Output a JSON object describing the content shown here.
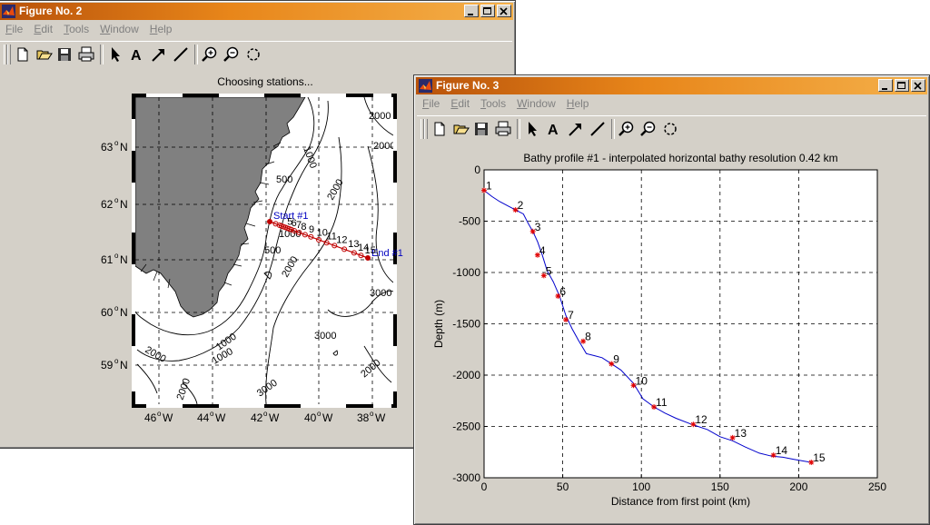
{
  "window2": {
    "title": "Figure No. 2",
    "menus": [
      "File",
      "Edit",
      "Tools",
      "Window",
      "Help"
    ],
    "plot_title": "Choosing stations...",
    "lat_labels": [
      "63",
      "62",
      "61",
      "60",
      "59"
    ],
    "lon_labels": [
      "46",
      "44",
      "42",
      "40",
      "38"
    ],
    "lat_suffix": "N",
    "lon_suffix": "W",
    "degree_mark": "o",
    "contour_labels": [
      "2000",
      "1000",
      "500",
      "2000",
      "2000",
      "1000",
      "500",
      "2000",
      "1000",
      "2000",
      "1000",
      "2000",
      "3000",
      "3000",
      "3000",
      "2000"
    ],
    "start_label": "Start #1",
    "end_label": "End #1",
    "station_numbers": [
      "5",
      "6",
      "7",
      "8",
      "9",
      "10",
      "11",
      "12",
      "13",
      "14",
      "15"
    ]
  },
  "window3": {
    "title": "Figure No. 3",
    "menus": [
      "File",
      "Edit",
      "Tools",
      "Window",
      "Help"
    ]
  },
  "chart_data": {
    "type": "line",
    "title": "Bathy profile #1 - interpolated horizontal bathy resolution  0.42 km",
    "xlabel": "Distance from first point (km)",
    "ylabel": "Depth (m)",
    "xlim": [
      0,
      250
    ],
    "ylim": [
      -3000,
      0
    ],
    "xticks": [
      0,
      50,
      100,
      150,
      200,
      250
    ],
    "yticks": [
      0,
      -500,
      -1000,
      -1500,
      -2000,
      -2500,
      -3000
    ],
    "grid": true,
    "series": [
      {
        "x": [
          0,
          5,
          10,
          15,
          20,
          25,
          28,
          31,
          34,
          37,
          40,
          44,
          48,
          52,
          56,
          60,
          65,
          70,
          75,
          80,
          87,
          95,
          101,
          108,
          115,
          122,
          132,
          142,
          150,
          158,
          166,
          175,
          183,
          190,
          197,
          208
        ],
        "values": [
          -200,
          -260,
          -310,
          -350,
          -390,
          -430,
          -520,
          -600,
          -700,
          -830,
          -980,
          -1090,
          -1230,
          -1420,
          -1550,
          -1660,
          -1790,
          -1810,
          -1830,
          -1880,
          -1950,
          -2080,
          -2230,
          -2310,
          -2370,
          -2420,
          -2480,
          -2530,
          -2600,
          -2640,
          -2700,
          -2760,
          -2790,
          -2800,
          -2820,
          -2850
        ]
      }
    ],
    "stations": {
      "labels": [
        "1",
        "2",
        "3",
        "4",
        "5",
        "6",
        "7",
        "8",
        "9",
        "10",
        "11",
        "12",
        "13",
        "14",
        "15"
      ],
      "x": [
        0,
        20,
        31,
        34,
        38,
        47,
        52,
        63,
        81,
        95,
        108,
        133,
        158,
        184,
        208
      ],
      "values": [
        -200,
        -390,
        -600,
        -830,
        -1030,
        -1230,
        -1460,
        -1670,
        -1890,
        -2100,
        -2310,
        -2480,
        -2610,
        -2780,
        -2850
      ]
    }
  }
}
